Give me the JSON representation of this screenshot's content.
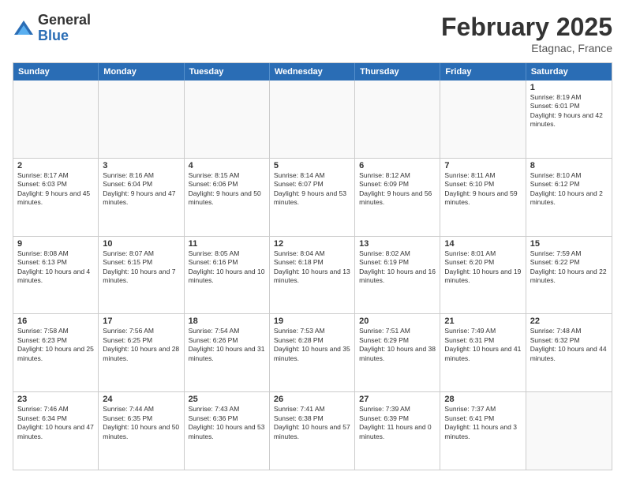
{
  "header": {
    "logo_general": "General",
    "logo_blue": "Blue",
    "month_title": "February 2025",
    "location": "Etagnac, France"
  },
  "calendar": {
    "days_of_week": [
      "Sunday",
      "Monday",
      "Tuesday",
      "Wednesday",
      "Thursday",
      "Friday",
      "Saturday"
    ],
    "rows": [
      [
        {
          "day": "",
          "info": ""
        },
        {
          "day": "",
          "info": ""
        },
        {
          "day": "",
          "info": ""
        },
        {
          "day": "",
          "info": ""
        },
        {
          "day": "",
          "info": ""
        },
        {
          "day": "",
          "info": ""
        },
        {
          "day": "1",
          "info": "Sunrise: 8:19 AM\nSunset: 6:01 PM\nDaylight: 9 hours and 42 minutes."
        }
      ],
      [
        {
          "day": "2",
          "info": "Sunrise: 8:17 AM\nSunset: 6:03 PM\nDaylight: 9 hours and 45 minutes."
        },
        {
          "day": "3",
          "info": "Sunrise: 8:16 AM\nSunset: 6:04 PM\nDaylight: 9 hours and 47 minutes."
        },
        {
          "day": "4",
          "info": "Sunrise: 8:15 AM\nSunset: 6:06 PM\nDaylight: 9 hours and 50 minutes."
        },
        {
          "day": "5",
          "info": "Sunrise: 8:14 AM\nSunset: 6:07 PM\nDaylight: 9 hours and 53 minutes."
        },
        {
          "day": "6",
          "info": "Sunrise: 8:12 AM\nSunset: 6:09 PM\nDaylight: 9 hours and 56 minutes."
        },
        {
          "day": "7",
          "info": "Sunrise: 8:11 AM\nSunset: 6:10 PM\nDaylight: 9 hours and 59 minutes."
        },
        {
          "day": "8",
          "info": "Sunrise: 8:10 AM\nSunset: 6:12 PM\nDaylight: 10 hours and 2 minutes."
        }
      ],
      [
        {
          "day": "9",
          "info": "Sunrise: 8:08 AM\nSunset: 6:13 PM\nDaylight: 10 hours and 4 minutes."
        },
        {
          "day": "10",
          "info": "Sunrise: 8:07 AM\nSunset: 6:15 PM\nDaylight: 10 hours and 7 minutes."
        },
        {
          "day": "11",
          "info": "Sunrise: 8:05 AM\nSunset: 6:16 PM\nDaylight: 10 hours and 10 minutes."
        },
        {
          "day": "12",
          "info": "Sunrise: 8:04 AM\nSunset: 6:18 PM\nDaylight: 10 hours and 13 minutes."
        },
        {
          "day": "13",
          "info": "Sunrise: 8:02 AM\nSunset: 6:19 PM\nDaylight: 10 hours and 16 minutes."
        },
        {
          "day": "14",
          "info": "Sunrise: 8:01 AM\nSunset: 6:20 PM\nDaylight: 10 hours and 19 minutes."
        },
        {
          "day": "15",
          "info": "Sunrise: 7:59 AM\nSunset: 6:22 PM\nDaylight: 10 hours and 22 minutes."
        }
      ],
      [
        {
          "day": "16",
          "info": "Sunrise: 7:58 AM\nSunset: 6:23 PM\nDaylight: 10 hours and 25 minutes."
        },
        {
          "day": "17",
          "info": "Sunrise: 7:56 AM\nSunset: 6:25 PM\nDaylight: 10 hours and 28 minutes."
        },
        {
          "day": "18",
          "info": "Sunrise: 7:54 AM\nSunset: 6:26 PM\nDaylight: 10 hours and 31 minutes."
        },
        {
          "day": "19",
          "info": "Sunrise: 7:53 AM\nSunset: 6:28 PM\nDaylight: 10 hours and 35 minutes."
        },
        {
          "day": "20",
          "info": "Sunrise: 7:51 AM\nSunset: 6:29 PM\nDaylight: 10 hours and 38 minutes."
        },
        {
          "day": "21",
          "info": "Sunrise: 7:49 AM\nSunset: 6:31 PM\nDaylight: 10 hours and 41 minutes."
        },
        {
          "day": "22",
          "info": "Sunrise: 7:48 AM\nSunset: 6:32 PM\nDaylight: 10 hours and 44 minutes."
        }
      ],
      [
        {
          "day": "23",
          "info": "Sunrise: 7:46 AM\nSunset: 6:34 PM\nDaylight: 10 hours and 47 minutes."
        },
        {
          "day": "24",
          "info": "Sunrise: 7:44 AM\nSunset: 6:35 PM\nDaylight: 10 hours and 50 minutes."
        },
        {
          "day": "25",
          "info": "Sunrise: 7:43 AM\nSunset: 6:36 PM\nDaylight: 10 hours and 53 minutes."
        },
        {
          "day": "26",
          "info": "Sunrise: 7:41 AM\nSunset: 6:38 PM\nDaylight: 10 hours and 57 minutes."
        },
        {
          "day": "27",
          "info": "Sunrise: 7:39 AM\nSunset: 6:39 PM\nDaylight: 11 hours and 0 minutes."
        },
        {
          "day": "28",
          "info": "Sunrise: 7:37 AM\nSunset: 6:41 PM\nDaylight: 11 hours and 3 minutes."
        },
        {
          "day": "",
          "info": ""
        }
      ]
    ]
  }
}
